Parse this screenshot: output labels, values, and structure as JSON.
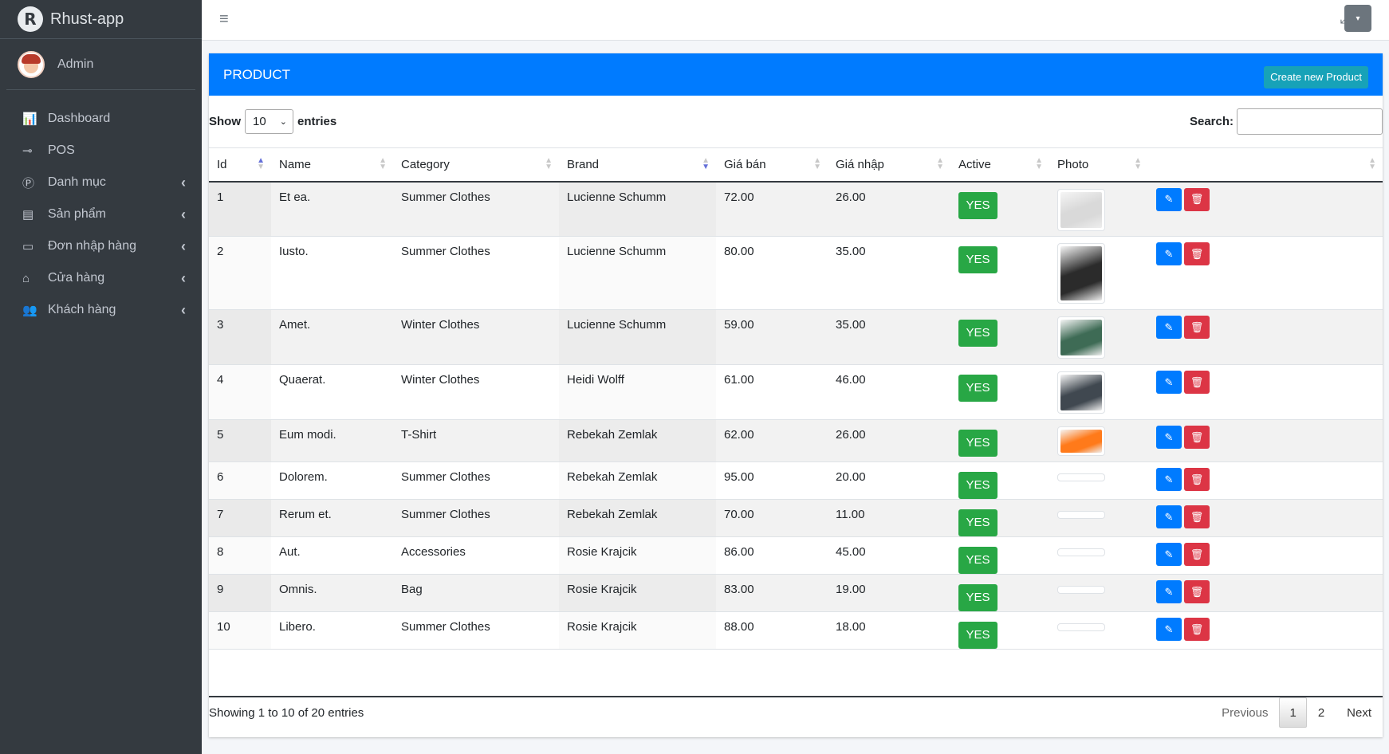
{
  "app": {
    "brand": "Rhust-app",
    "brand_letter": "R",
    "user": "Admin"
  },
  "sidebar": {
    "items": [
      {
        "label": "Dashboard",
        "icon": "chart-icon",
        "glyph": "📊",
        "has_children": false
      },
      {
        "label": "POS",
        "icon": "tag-icon",
        "glyph": "⊸",
        "has_children": false
      },
      {
        "label": "Danh mục",
        "icon": "circle-p-icon",
        "glyph": "Ⓟ",
        "has_children": true
      },
      {
        "label": "Sản phẩm",
        "icon": "store-icon",
        "glyph": "▤",
        "has_children": true
      },
      {
        "label": "Đơn nhập hàng",
        "icon": "invoice-icon",
        "glyph": "▭",
        "has_children": true
      },
      {
        "label": "Cửa hàng",
        "icon": "shop-icon",
        "glyph": "⌂",
        "has_children": true
      },
      {
        "label": "Khách hàng",
        "icon": "users-icon",
        "glyph": "👥",
        "has_children": true
      }
    ],
    "chevron": "‹"
  },
  "topbar": {
    "menu_glyph": "≡",
    "expand_glyph": "⤢",
    "dropdown_glyph": "▾"
  },
  "card": {
    "title": "PRODUCT",
    "create_label": "Create new Product"
  },
  "controls": {
    "show_label": "Show",
    "length_value": "10",
    "entries_label": "entries",
    "search_label": "Search:",
    "search_value": ""
  },
  "table": {
    "columns": [
      {
        "label": "Id",
        "sort": "asc"
      },
      {
        "label": "Name",
        "sort": "none"
      },
      {
        "label": "Category",
        "sort": "none"
      },
      {
        "label": "Brand",
        "sort": "desc"
      },
      {
        "label": "Giá bán",
        "sort": "none"
      },
      {
        "label": "Giá nhập",
        "sort": "none"
      },
      {
        "label": "Active",
        "sort": "none"
      },
      {
        "label": "Photo",
        "sort": "none"
      },
      {
        "label": "",
        "sort": "none"
      }
    ],
    "rows": [
      {
        "id": "1",
        "name": "Et ea.",
        "category": "Summer Clothes",
        "brand": "Lucienne Schumm",
        "price": "72.00",
        "cost": "26.00",
        "active": "YES",
        "photo": "white-shirt-photo",
        "photo_color": "#d9d9d9"
      },
      {
        "id": "2",
        "name": "Iusto.",
        "category": "Summer Clothes",
        "brand": "Lucienne Schumm",
        "price": "80.00",
        "cost": "35.00",
        "active": "YES",
        "photo": "black-tshirt-photo",
        "photo_color": "#2b2b2b"
      },
      {
        "id": "3",
        "name": "Amet.",
        "category": "Winter Clothes",
        "brand": "Lucienne Schumm",
        "price": "59.00",
        "cost": "35.00",
        "active": "YES",
        "photo": "hoodie-photo",
        "photo_color": "#3e6b55"
      },
      {
        "id": "4",
        "name": "Quaerat.",
        "category": "Winter Clothes",
        "brand": "Heidi Wolff",
        "price": "61.00",
        "cost": "46.00",
        "active": "YES",
        "photo": "black-coat-photo",
        "photo_color": "#404850"
      },
      {
        "id": "5",
        "name": "Eum modi.",
        "category": "T-Shirt",
        "brand": "Rebekah Zemlak",
        "price": "62.00",
        "cost": "26.00",
        "active": "YES",
        "photo": "orange-tshirts-photo",
        "photo_color": "#ff7a1a"
      },
      {
        "id": "6",
        "name": "Dolorem.",
        "category": "Summer Clothes",
        "brand": "Rebekah Zemlak",
        "price": "95.00",
        "cost": "20.00",
        "active": "YES",
        "photo": "",
        "photo_color": ""
      },
      {
        "id": "7",
        "name": "Rerum et.",
        "category": "Summer Clothes",
        "brand": "Rebekah Zemlak",
        "price": "70.00",
        "cost": "11.00",
        "active": "YES",
        "photo": "",
        "photo_color": ""
      },
      {
        "id": "8",
        "name": "Aut.",
        "category": "Accessories",
        "brand": "Rosie Krajcik",
        "price": "86.00",
        "cost": "45.00",
        "active": "YES",
        "photo": "",
        "photo_color": ""
      },
      {
        "id": "9",
        "name": "Omnis.",
        "category": "Bag",
        "brand": "Rosie Krajcik",
        "price": "83.00",
        "cost": "19.00",
        "active": "YES",
        "photo": "",
        "photo_color": ""
      },
      {
        "id": "10",
        "name": "Libero.",
        "category": "Summer Clothes",
        "brand": "Rosie Krajcik",
        "price": "88.00",
        "cost": "18.00",
        "active": "YES",
        "photo": "",
        "photo_color": ""
      }
    ],
    "edit_glyph": "✎",
    "delete_glyph": "🗑"
  },
  "footer": {
    "info": "Showing 1 to 10 of 20 entries",
    "previous": "Previous",
    "pages": [
      "1",
      "2"
    ],
    "current_page": "1",
    "next": "Next"
  },
  "colors": {
    "primary": "#007bff",
    "info": "#17a2b8",
    "success": "#28a745",
    "danger": "#dc3545",
    "sidebar": "#343a40"
  }
}
